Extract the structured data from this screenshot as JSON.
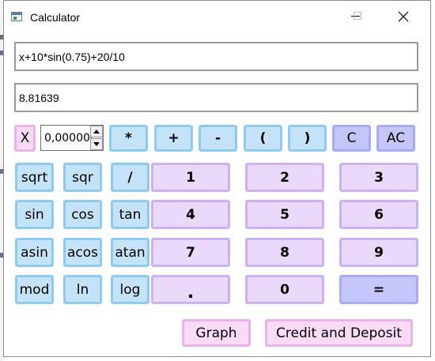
{
  "window": {
    "title": "Calculator"
  },
  "display": {
    "expression": "x+10*sin(0.75)+20/10",
    "result": "8.81639"
  },
  "x_control": {
    "x_label": "X",
    "x_value": "0,000000"
  },
  "operators": {
    "multiply": "*",
    "plus": "+",
    "minus": "-",
    "open_paren": "(",
    "close_paren": ")",
    "clear": "C",
    "all_clear": "AC",
    "divide": "/"
  },
  "functions": {
    "sqrt": "sqrt",
    "sqr": "sqr",
    "sin": "sin",
    "cos": "cos",
    "tan": "tan",
    "asin": "asin",
    "acos": "acos",
    "atan": "atan",
    "mod": "mod",
    "ln": "ln",
    "log": "log"
  },
  "digits": {
    "d1": "1",
    "d2": "2",
    "d3": "3",
    "d4": "4",
    "d5": "5",
    "d6": "6",
    "d7": "7",
    "d8": "8",
    "d9": "9",
    "d0": "0",
    "dot": ".",
    "equals": "="
  },
  "actions": {
    "graph": "Graph",
    "credit_deposit": "Credit and Deposit"
  },
  "colors": {
    "function_button": "#c4e2f8",
    "digit_button": "#ead9fa",
    "clear_button": "#c4c6f9",
    "accent_button": "#f9dbf6"
  }
}
